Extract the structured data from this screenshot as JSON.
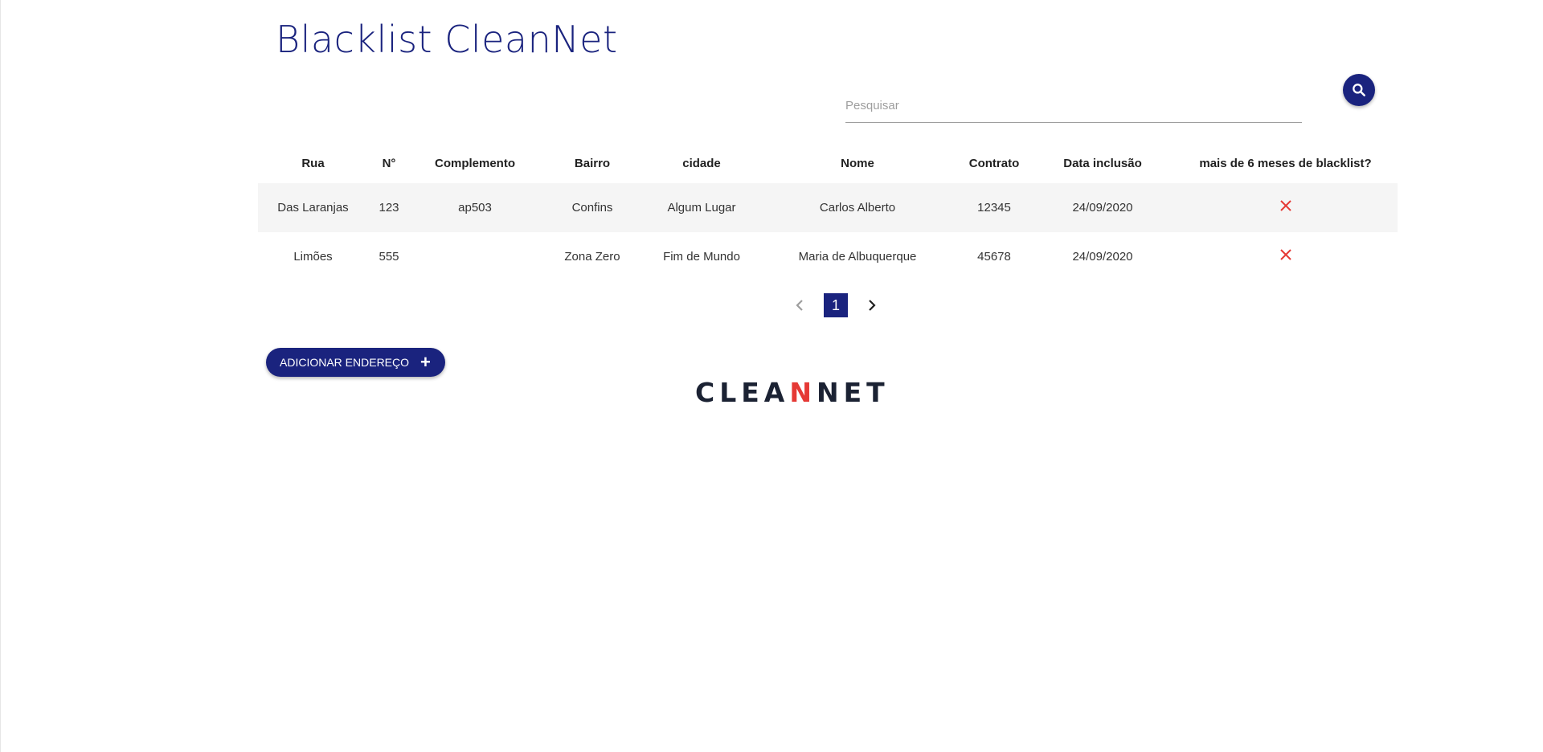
{
  "header": {
    "title": "Blacklist CleanNet"
  },
  "search": {
    "placeholder": "Pesquisar",
    "value": "",
    "button_icon": "search-icon"
  },
  "table": {
    "columns": [
      "Rua",
      "N°",
      "Complemento",
      "Bairro",
      "cidade",
      "Nome",
      "Contrato",
      "Data inclusão",
      "mais de 6 meses de blacklist?"
    ],
    "rows": [
      {
        "rua": "Das Laranjas",
        "numero": "123",
        "complemento": "ap503",
        "bairro": "Confins",
        "cidade": "Algum Lugar",
        "nome": "Carlos Alberto",
        "contrato": "12345",
        "data_inclusao": "24/09/2020",
        "mais_de_6_meses_icon": "close-icon"
      },
      {
        "rua": "Limões",
        "numero": "555",
        "complemento": "",
        "bairro": "Zona Zero",
        "cidade": "Fim de Mundo",
        "nome": "Maria de Albuquerque",
        "contrato": "45678",
        "data_inclusao": "24/09/2020",
        "mais_de_6_meses_icon": "close-icon"
      }
    ]
  },
  "pagination": {
    "current_page": "1",
    "prev_icon": "chevron-left-icon",
    "next_icon": "chevron-right-icon"
  },
  "actions": {
    "add_label": "ADICIONAR ENDEREÇO",
    "add_icon": "plus-icon"
  },
  "footer": {
    "logo_text_start": "CLEA",
    "logo_text_accent": "N",
    "logo_text_end": "NET"
  },
  "colors": {
    "primary": "#1a237e",
    "danger": "#e53935",
    "row_stripe": "#f5f5f5"
  }
}
